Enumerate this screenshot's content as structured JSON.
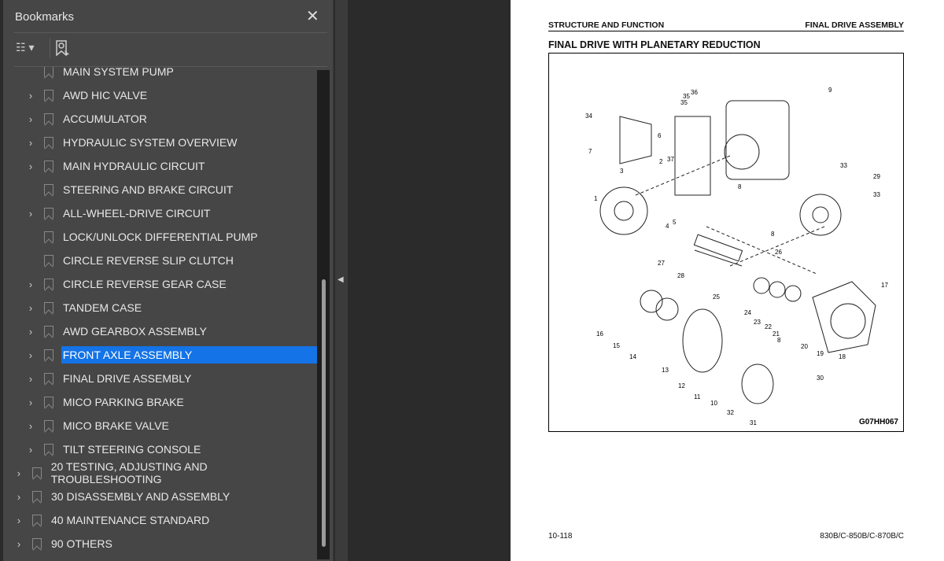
{
  "panel": {
    "title": "Bookmarks",
    "close_icon": "close-icon",
    "options_icon": "list-options-icon",
    "find_icon": "find-bookmark-icon"
  },
  "bookmarks": [
    {
      "label": "MAIN SYSTEM PUMP",
      "level": 2,
      "expandable": false
    },
    {
      "label": "AWD HIC VALVE",
      "level": 2,
      "expandable": true
    },
    {
      "label": "ACCUMULATOR",
      "level": 2,
      "expandable": true
    },
    {
      "label": "HYDRAULIC SYSTEM OVERVIEW",
      "level": 2,
      "expandable": true
    },
    {
      "label": "MAIN HYDRAULIC CIRCUIT",
      "level": 2,
      "expandable": true
    },
    {
      "label": "STEERING AND BRAKE CIRCUIT",
      "level": 2,
      "expandable": false
    },
    {
      "label": "ALL-WHEEL-DRIVE CIRCUIT",
      "level": 2,
      "expandable": true
    },
    {
      "label": "LOCK/UNLOCK DIFFERENTIAL PUMP",
      "level": 2,
      "expandable": false
    },
    {
      "label": "CIRCLE REVERSE SLIP CLUTCH",
      "level": 2,
      "expandable": false
    },
    {
      "label": "CIRCLE REVERSE GEAR CASE",
      "level": 2,
      "expandable": true
    },
    {
      "label": "TANDEM CASE",
      "level": 2,
      "expandable": true
    },
    {
      "label": "AWD GEARBOX ASSEMBLY",
      "level": 2,
      "expandable": true
    },
    {
      "label": "FRONT AXLE ASSEMBLY",
      "level": 2,
      "expandable": true,
      "selected": true
    },
    {
      "label": "FINAL DRIVE ASSEMBLY",
      "level": 2,
      "expandable": true
    },
    {
      "label": "MICO PARKING BRAKE",
      "level": 2,
      "expandable": true
    },
    {
      "label": "MICO BRAKE VALVE",
      "level": 2,
      "expandable": true
    },
    {
      "label": "TILT STEERING CONSOLE",
      "level": 2,
      "expandable": true
    },
    {
      "label": "20 TESTING, ADJUSTING AND TROUBLESHOOTING",
      "level": 1,
      "expandable": true
    },
    {
      "label": "30 DISASSEMBLY AND ASSEMBLY",
      "level": 1,
      "expandable": true
    },
    {
      "label": "40 MAINTENANCE STANDARD",
      "level": 1,
      "expandable": true
    },
    {
      "label": "90 OTHERS",
      "level": 1,
      "expandable": true
    }
  ],
  "document": {
    "header_left": "STRUCTURE AND FUNCTION",
    "header_right": "FINAL DRIVE ASSEMBLY",
    "title": "FINAL DRIVE WITH PLANETARY REDUCTION",
    "figure_code": "G07HH067",
    "callouts": [
      "9",
      "36",
      "35",
      "35",
      "34",
      "7",
      "6",
      "2",
      "37",
      "3",
      "1",
      "4",
      "5",
      "8",
      "33",
      "29",
      "33",
      "8",
      "26",
      "27",
      "28",
      "25",
      "17",
      "24",
      "23",
      "22",
      "21",
      "16",
      "15",
      "14",
      "13",
      "8",
      "20",
      "19",
      "18",
      "12",
      "11",
      "10",
      "32",
      "31",
      "30"
    ],
    "page_number": "10-118",
    "model": "830B/C-850B/C-870B/C"
  },
  "colors": {
    "selection": "#1473e6",
    "panel": "#464646"
  }
}
